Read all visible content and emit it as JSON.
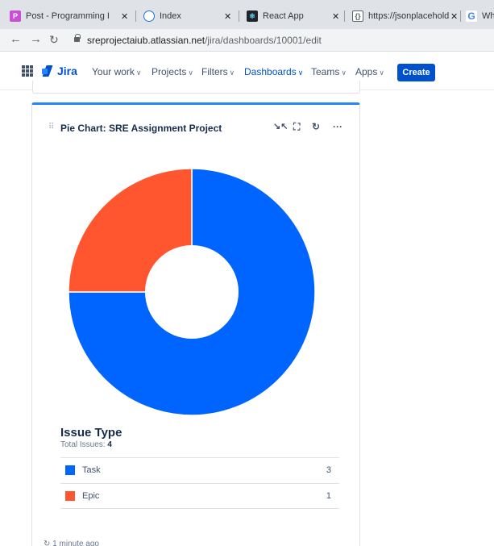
{
  "browser": {
    "tabs": [
      {
        "label": "Post - Programming I",
        "icon": "pen-icon",
        "color": "#c94fd6"
      },
      {
        "label": "Index",
        "icon": "globe-icon",
        "color": "#1a73e8"
      },
      {
        "label": "React App",
        "icon": "react-icon",
        "color": "#20232a"
      },
      {
        "label": "https://jsonplacehold",
        "icon": "json-icon",
        "color": "#5f6368"
      },
      {
        "label": "Wh",
        "icon": "google-icon",
        "color": "#4285f4"
      }
    ],
    "url_host": "sreprojectaiub.atlassian.net",
    "url_path": "/jira/dashboards/10001/edit"
  },
  "nav": {
    "logo": "Jira",
    "items": [
      "Your work",
      "Projects",
      "Filters",
      "Dashboards",
      "Teams",
      "Apps"
    ],
    "active": "Dashboards",
    "create_label": "Create"
  },
  "gadget": {
    "title": "Pie Chart: SRE Assignment Project",
    "legend_title": "Issue Type",
    "total_label": "Total Issues:",
    "total_value": "4",
    "rows": [
      {
        "name": "Task",
        "count": "3"
      },
      {
        "name": "Epic",
        "count": "1"
      }
    ],
    "updated": "1 minute ago"
  },
  "chart_data": {
    "type": "pie",
    "categories": [
      "Task",
      "Epic"
    ],
    "values": [
      3,
      1
    ],
    "colors": [
      "#0065ff",
      "#ff5630"
    ],
    "donut": true,
    "title": "Issue Type"
  }
}
